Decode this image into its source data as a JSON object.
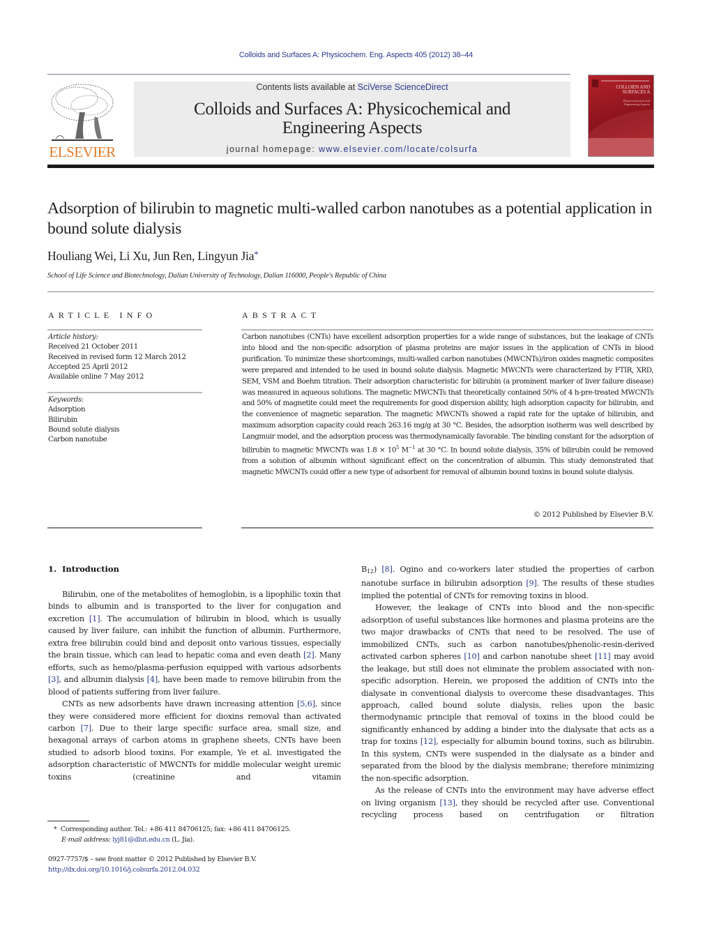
{
  "running_header": "Colloids and Surfaces A: Physicochem. Eng. Aspects 405 (2012) 38–44",
  "masthead": {
    "publisher_logo_text": "ELSEVIER",
    "contents_prefix": "Contents lists available at ",
    "contents_link": "SciVerse ScienceDirect",
    "journal_title_line1": "Colloids and Surfaces A: Physicochemical and",
    "journal_title_line2": "Engineering Aspects",
    "homepage_prefix": "journal homepage: ",
    "homepage_link": "www.elsevier.com/locate/colsurfa",
    "cover_title_line1": "COLLOIDS AND",
    "cover_title_line2": "SURFACES A",
    "cover_sub_line1": "Physicochemical and",
    "cover_sub_line2": "Engineering Aspects"
  },
  "article": {
    "title": "Adsorption of bilirubin to magnetic multi-walled carbon nanotubes as a potential application in bound solute dialysis",
    "authors": "Houliang Wei, Li Xu, Jun Ren, Lingyun Jia",
    "corresponding_mark": "*",
    "affiliation": "School of Life Science and Biotechnology, Dalian University of Technology, Dalian 116000, People's Republic of China"
  },
  "article_info": {
    "heading": "ARTICLE INFO",
    "history_label": "Article history:",
    "history": [
      "Received 21 October 2011",
      "Received in revised form 12 March 2012",
      "Accepted 25 April 2012",
      "Available online 7 May 2012"
    ],
    "keywords_label": "Keywords:",
    "keywords": [
      "Adsorption",
      "Bilirubin",
      "Bound solute dialysis",
      "Carbon nanotube"
    ]
  },
  "abstract": {
    "heading": "ABSTRACT",
    "part1": "Carbon nanotubes (CNTs) have excellent adsorption properties for a wide range of substances, but the leakage of CNTs into blood and the non-specific adsorption of plasma proteins are major issues in the application of CNTs in blood purification. To minimize these shortcomings, multi-walled carbon nanotubes (MWCNTs)/iron oxides magnetic composites were prepared and intended to be used in bound solute dialysis. Magnetic MWCNTs were characterized by FTIR, XRD, SEM, VSM and Boehm titration. Their adsorption characteristic for bilirubin (a prominent marker of liver failure disease) was measured in aqueous solutions. The magnetic MWCNTs that theoretically contained 50% of 4 h-pre-treated MWCNTs and 50% of magnetite could meet the requirements for good dispersion ability, high adsorption capacity for bilirubin, and the convenience of magnetic separation. The magnetic MWCNTs showed a rapid rate for the uptake of bilirubin, and maximum adsorption capacity could reach 263.16 mg/g at 30 °C. Besides, the adsorption isotherm was well described by Langmuir model, and the adsorption process was thermodynamically favorable. The binding constant for the adsorption of bilirubin to magnetic MWCNTs was ",
    "binding_constant": "1.8 × 10",
    "binding_exp": "5",
    "binding_unit": " M",
    "binding_unit_exp": "−1",
    "part2": " at 30 °C. In bound solute dialysis, 35% of bilirubin could be removed from a solution of albumin without significant effect on the concentration of albumin. This study demonstrated that magnetic MWCNTs could offer a new type of adsorbent for removal of albumin bound toxins in bound solute dialysis.",
    "copyright": "© 2012 Published by Elsevier B.V."
  },
  "introduction": {
    "number": "1.",
    "heading": "Introduction",
    "p1": [
      {
        "t": "Bilirubin, one of the metabolites of hemoglobin, is a lipophilic toxin that binds to albumin and is transported to the liver for conjugation and excretion "
      },
      {
        "ref": "[1]"
      },
      {
        "t": ". The accumulation of bilirubin in blood, which is usually caused by liver failure, can inhibit the function of albumin. Furthermore, extra free bilirubin could bind and deposit onto various tissues, especially the brain tissue, which can lead to hepatic coma and even death "
      },
      {
        "ref": "[2]"
      },
      {
        "t": ". Many efforts, such as hemo/plasma-perfusion equipped with various adsorbents "
      },
      {
        "ref": "[3]"
      },
      {
        "t": ", and albumin dialysis "
      },
      {
        "ref": "[4]"
      },
      {
        "t": ", have been made to remove bilirubin from the blood of patients suffering from liver failure."
      }
    ],
    "p2": [
      {
        "t": "CNTs as new adsorbents have drawn increasing attention "
      },
      {
        "ref": "[5,6]"
      },
      {
        "t": ", since they were considered more efficient for dioxins removal than activated carbon "
      },
      {
        "ref": "[7]"
      },
      {
        "t": ". Due to their large specific surface area, small size, and hexagonal arrays of carbon atoms in graphene sheets, CNTs have been studied to adsorb blood toxins. For example, Ye et al. investigated the adsorption characteristic of MWCNTs for middle molecular weight uremic toxins (creatinine and vitamin"
      }
    ],
    "p2_cont": [
      {
        "t": "B"
      },
      {
        "sub": "12"
      },
      {
        "t": ") "
      },
      {
        "ref": "[8]"
      },
      {
        "t": ". Ogino and co-workers later studied the properties of carbon nanotube surface in bilirubin adsorption "
      },
      {
        "ref": "[9]"
      },
      {
        "t": ". The results of these studies implied the potential of CNTs for removing toxins in blood."
      }
    ],
    "p3": [
      {
        "t": "However, the leakage of CNTs into blood and the non-specific adsorption of useful substances like hormones and plasma proteins are the two major drawbacks of CNTs that need to be resolved. The use of immobilized CNTs, such as carbon nanotubes/phenolic-resin-derived activated carbon spheres "
      },
      {
        "ref": "[10]"
      },
      {
        "t": " and carbon nanotube sheet "
      },
      {
        "ref": "[11]"
      },
      {
        "t": " may avoid the leakage, but still does not eliminate the problem associated with non-specific adsorption. Herein, we proposed the addition of CNTs into the dialysate in conventional dialysis to overcome these disadvantages. This approach, called bound solute dialysis, relies upon the basic thermodynamic principle that removal of toxins in the blood could be significantly enhanced by adding a binder into the dialysate that acts as a trap for toxins "
      },
      {
        "ref": "[12]"
      },
      {
        "t": ", especially for albumin bound toxins, such as bilirubin. In this system, CNTs were suspended in the dialysate as a binder and separated from the blood by the dialysis membrane; therefore minimizing the non-specific adsorption."
      }
    ],
    "p4": [
      {
        "t": "As the release of CNTs into the environment may have adverse effect on living organism "
      },
      {
        "ref": "[13]"
      },
      {
        "t": ", they should be recycled after use. Conventional recycling process based on centrifugation or filtration"
      }
    ]
  },
  "footnote": {
    "mark": "*",
    "contact": "Corresponding author. Tel.: +86 411 84706125; fax: +86 411 84706125.",
    "email_label": "E-mail address:",
    "email": "lyj81@dlut.edu.cn",
    "email_suffix": " (L. Jia)."
  },
  "front_matter": {
    "issn_line": "0927-7757/$ – see front matter © 2012 Published by Elsevier B.V.",
    "doi": "http://dx.doi.org/10.1016/j.colsurfa.2012.04.032"
  },
  "colors": {
    "link": "#2b3a8c",
    "elsevier_orange": "#e37b2a",
    "masthead_bg": "#ececec",
    "cover_red": "#a01a22"
  }
}
